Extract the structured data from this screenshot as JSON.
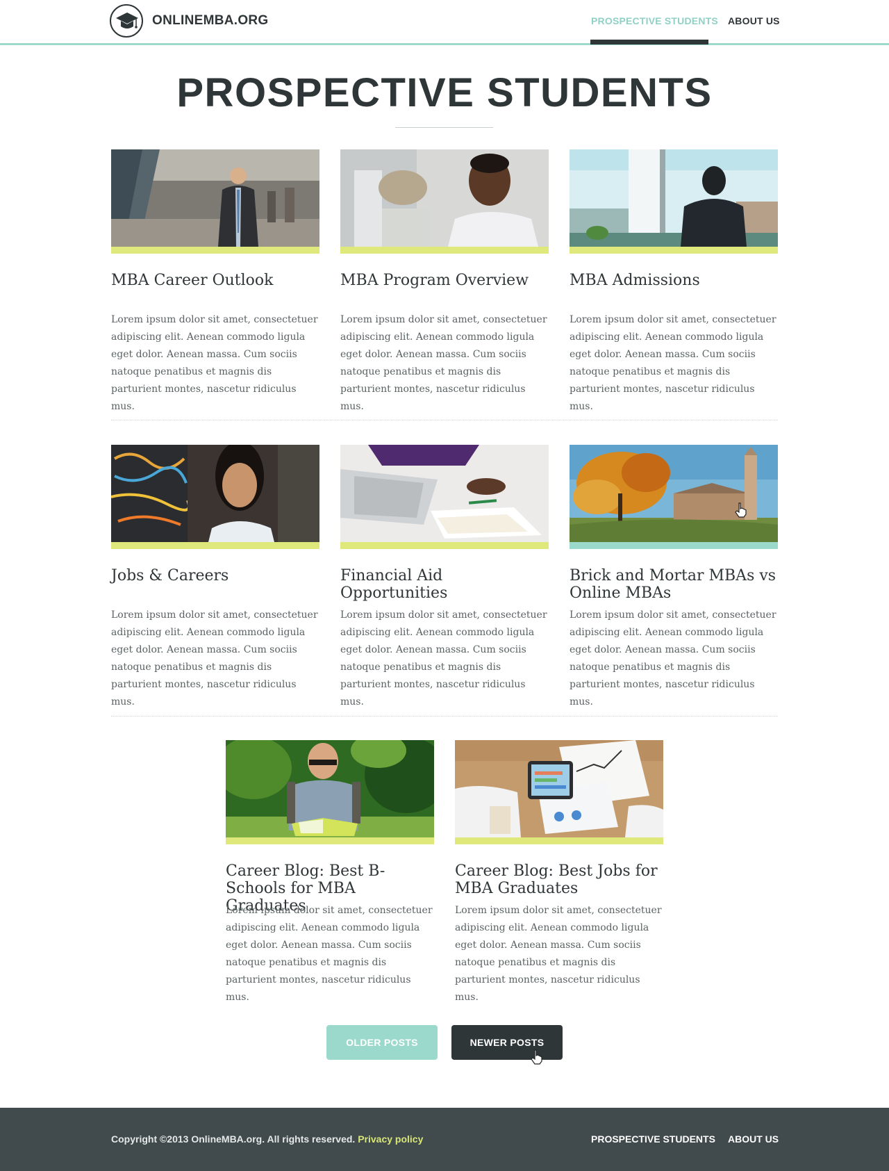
{
  "header": {
    "brand": "ONLINEMBA.ORG",
    "nav": {
      "prospective_students": "PROSPECTIVE STUDENTS",
      "about_us": "ABOUT US"
    }
  },
  "main": {
    "title": "PROSPECTIVE STUDENTS",
    "posts": [
      {
        "title": "MBA Career Outlook",
        "excerpt": "Lorem ipsum dolor sit amet, consectetuer adipiscing elit. Aenean commodo ligula eget dolor. Aenean massa. Cum sociis natoque penatibus et magnis dis parturient montes, nascetur ridiculus mus."
      },
      {
        "title": "MBA Program Overview",
        "excerpt": "Lorem ipsum dolor sit amet, consectetuer adipiscing elit. Aenean commodo ligula eget dolor. Aenean massa. Cum sociis natoque penatibus et magnis dis parturient montes, nascetur ridiculus mus."
      },
      {
        "title": "MBA Admissions",
        "excerpt": "Lorem ipsum dolor sit amet, consectetuer adipiscing elit. Aenean commodo ligula eget dolor. Aenean massa. Cum sociis natoque penatibus et magnis dis parturient montes, nascetur ridiculus mus."
      },
      {
        "title": "Jobs & Careers",
        "excerpt": "Lorem ipsum dolor sit amet, consectetuer adipiscing elit. Aenean commodo ligula eget dolor. Aenean massa. Cum sociis natoque penatibus et magnis dis parturient montes, nascetur ridiculus mus."
      },
      {
        "title": "Financial Aid Opportunities",
        "excerpt": "Lorem ipsum dolor sit amet, consectetuer adipiscing elit. Aenean commodo ligula eget dolor. Aenean massa. Cum sociis natoque penatibus et magnis dis parturient montes, nascetur ridiculus mus."
      },
      {
        "title": "Brick and Mortar MBAs vs Online MBAs",
        "excerpt": "Lorem ipsum dolor sit amet, consectetuer adipiscing elit. Aenean commodo ligula eget dolor. Aenean massa. Cum sociis natoque penatibus et magnis dis parturient montes, nascetur ridiculus mus."
      },
      {
        "title": "Career Blog: Best B-Schools for MBA Graduates",
        "excerpt": "Lorem ipsum dolor sit amet, consectetuer adipiscing elit. Aenean commodo ligula eget dolor. Aenean massa. Cum sociis natoque penatibus et magnis dis parturient montes, nascetur ridiculus mus."
      },
      {
        "title": "Career Blog: Best Jobs for MBA Graduates",
        "excerpt": "Lorem ipsum dolor sit amet, consectetuer adipiscing elit. Aenean commodo ligula eget dolor. Aenean massa. Cum sociis natoque penatibus et magnis dis parturient montes, nascetur ridiculus mus."
      }
    ]
  },
  "pagination": {
    "older": "OLDER POSTS",
    "newer": "NEWER POSTS"
  },
  "footer": {
    "copyright": "Copyright ©2013 OnlineMBA.org. All rights reserved.",
    "privacy": "Privacy policy",
    "nav": {
      "prospective_students": "PROSPECTIVE STUDENTS",
      "about_us": "ABOUT US"
    }
  },
  "colors": {
    "accent_teal": "#9ad9cc",
    "accent_lime": "#dfe87a",
    "dark": "#2f3638",
    "footer_bg": "#414a4c",
    "privacy_link": "#d8e67a"
  },
  "icons": {
    "logo": "graduation-cap-icon",
    "cursor": "hand-pointer-icon"
  }
}
